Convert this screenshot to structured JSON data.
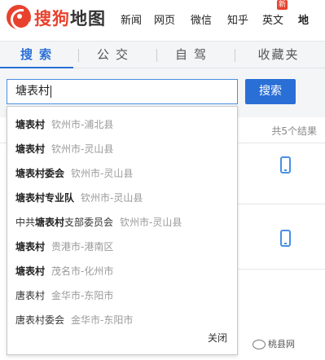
{
  "header": {
    "logo_main": "搜狗",
    "logo_sub": "地图",
    "nav": [
      "新闻",
      "网页",
      "微信",
      "知乎",
      "英文",
      "地"
    ],
    "new_badge": "新"
  },
  "tabs": [
    {
      "label": "搜索",
      "active": true
    },
    {
      "label": "公交",
      "active": false
    },
    {
      "label": "自驾",
      "active": false
    },
    {
      "label": "收藏夹",
      "active": false
    }
  ],
  "search": {
    "value": "塘表村",
    "button_label": "搜索"
  },
  "results": {
    "count_text": "共5个结果"
  },
  "suggestions": [
    {
      "kw": "塘表村",
      "rest": "",
      "loc": "钦州市-浦北县"
    },
    {
      "kw": "塘表村",
      "rest": "",
      "loc": "钦州市-灵山县"
    },
    {
      "kw": "塘表村",
      "rest": "委会",
      "loc": "钦州市-灵山县"
    },
    {
      "kw": "塘表村",
      "rest": "专业队",
      "loc": "钦州市-灵山县"
    },
    {
      "pre": "中共",
      "kw": "塘表村",
      "rest": "支部委员会",
      "loc": "钦州市-灵山县"
    },
    {
      "kw": "塘表村",
      "rest": "",
      "loc": "贵港市-港南区"
    },
    {
      "kw": "塘表村",
      "rest": "",
      "loc": "茂名市-化州市"
    },
    {
      "kw": "",
      "rest": "唐表村",
      "loc": "金华市-东阳市"
    },
    {
      "kw": "",
      "rest": "唐表村委会",
      "loc": "金华市-东阳市"
    }
  ],
  "dropdown": {
    "close_label": "关闭"
  },
  "watermark": {
    "text": "桃县网"
  },
  "colors": {
    "brand": "#e8422e",
    "accent": "#2a6fd6"
  }
}
